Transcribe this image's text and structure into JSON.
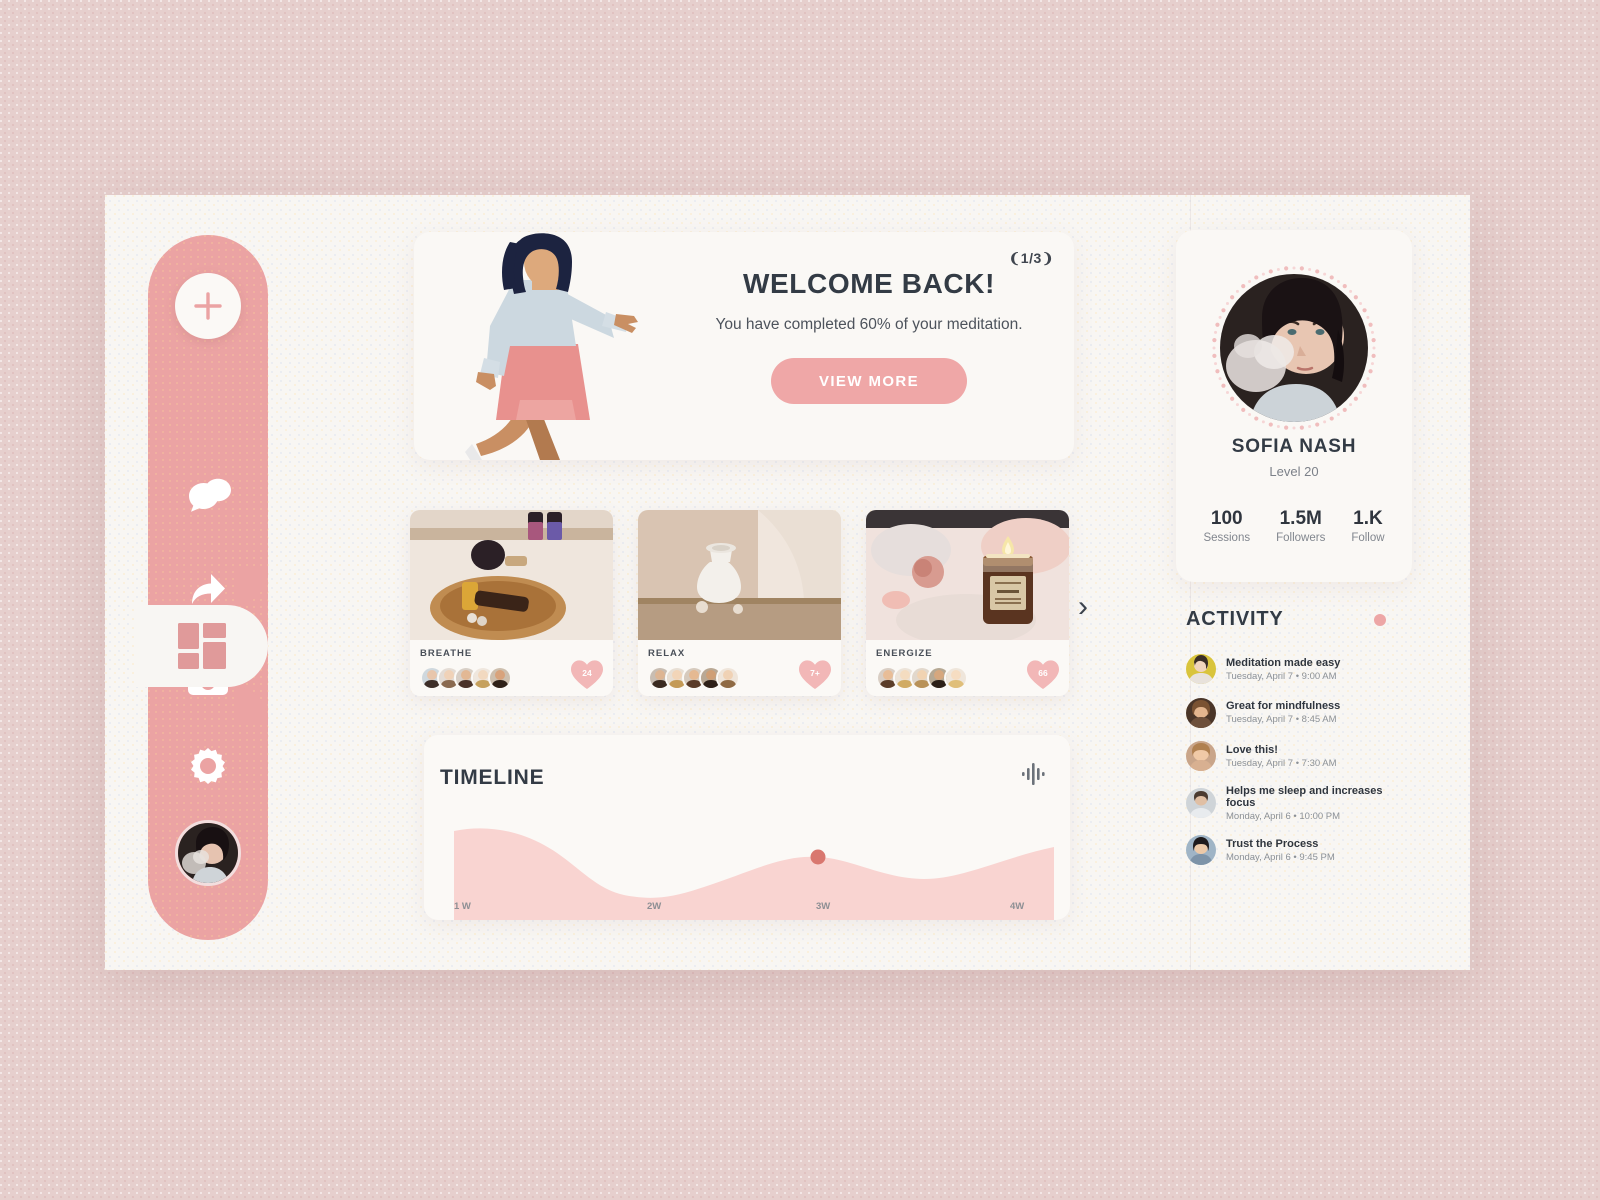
{
  "theme": {
    "page_bg": "#e6cfcd",
    "canvas_bg": "#f8f6f3",
    "accent": "#eba3a3",
    "accent_dark": "#d9776f",
    "text_dark": "#333b45",
    "text_muted": "#81868e"
  },
  "sidebar": {
    "items": [
      {
        "name": "add",
        "icon": "plus-icon",
        "active": false
      },
      {
        "name": "dashboard",
        "icon": "grid-icon",
        "active": true
      },
      {
        "name": "messages",
        "icon": "chat-bubbles-icon",
        "active": false
      },
      {
        "name": "share",
        "icon": "share-arrow-icon",
        "active": false
      },
      {
        "name": "save",
        "icon": "floppy-disk-icon",
        "active": false
      },
      {
        "name": "settings",
        "icon": "gear-icon",
        "active": false
      }
    ],
    "avatar_label": "user-avatar"
  },
  "welcome": {
    "pager": "❨1/3❩",
    "title": "WELCOME BACK!",
    "subtitle": "You have completed 60% of your meditation.",
    "cta_label": "VIEW MORE",
    "illustration": "walking-woman-illustration"
  },
  "categories": {
    "next_label": "›",
    "cards": [
      {
        "label": "BREATHE",
        "likes": "24",
        "image": "essential-oils-on-wooden-tray",
        "avatars": 5
      },
      {
        "label": "RELAX",
        "likes": "7+",
        "image": "white-ceramic-vase-on-wood",
        "avatars": 5
      },
      {
        "label": "ENERGIZE",
        "likes": "66",
        "image": "lit-candle-with-flowers",
        "avatars": 5
      }
    ]
  },
  "timeline": {
    "title": "TIMELINE",
    "icon": "equalizer-icon"
  },
  "chart_data": {
    "type": "area",
    "title": "TIMELINE",
    "x": [
      "1W",
      "2W",
      "3W",
      "4W"
    ],
    "categories": [
      "1 W",
      "2W",
      "3W",
      "4W"
    ],
    "values": [
      72,
      18,
      48,
      40
    ],
    "points": [
      {
        "x": 0,
        "y": 72
      },
      {
        "x": 0.12,
        "y": 74
      },
      {
        "x": 0.33,
        "y": 35
      },
      {
        "x": 0.42,
        "y": 18
      },
      {
        "x": 0.55,
        "y": 26
      },
      {
        "x": 0.7,
        "y": 48
      },
      {
        "x": 0.8,
        "y": 40
      },
      {
        "x": 0.9,
        "y": 33
      },
      {
        "x": 1.0,
        "y": 52
      }
    ],
    "marker": {
      "x": 0.7,
      "y": 48,
      "color": "#d9776f"
    },
    "xlabel": "",
    "ylabel": "",
    "ylim": [
      0,
      100
    ],
    "grid": false,
    "legend": false,
    "fill_color": "#f8d3d0",
    "tick_labels": [
      "1 W",
      "2W",
      "3W",
      "4W"
    ]
  },
  "profile": {
    "name": "SOFIA NASH",
    "level": "Level 20",
    "avatar": "profile-photo",
    "stats": [
      {
        "value": "100",
        "label": "Sessions"
      },
      {
        "value": "1.5M",
        "label": "Followers"
      },
      {
        "value": "1.K",
        "label": "Follow"
      }
    ]
  },
  "activity": {
    "title": "ACTIVITY",
    "badge": "notification-dot",
    "items": [
      {
        "text": "Meditation made easy",
        "date": "Tuesday, April 7 • 9:00 AM",
        "avatar": "#d9c43c"
      },
      {
        "text": "Great for mindfulness",
        "date": "Tuesday, April 7 • 8:45 AM",
        "avatar": "#6d4f3a"
      },
      {
        "text": "Love this!",
        "date": "Tuesday, April 7 • 7:30 AM",
        "avatar": "#c9a58a"
      },
      {
        "text": "Helps me sleep and increases focus",
        "date": "Monday, April 6 • 10:00 PM",
        "avatar": "#b9bec6"
      },
      {
        "text": "Trust the Process",
        "date": "Monday, April 6 • 9:45 PM",
        "avatar": "#8fa3b8"
      }
    ]
  }
}
